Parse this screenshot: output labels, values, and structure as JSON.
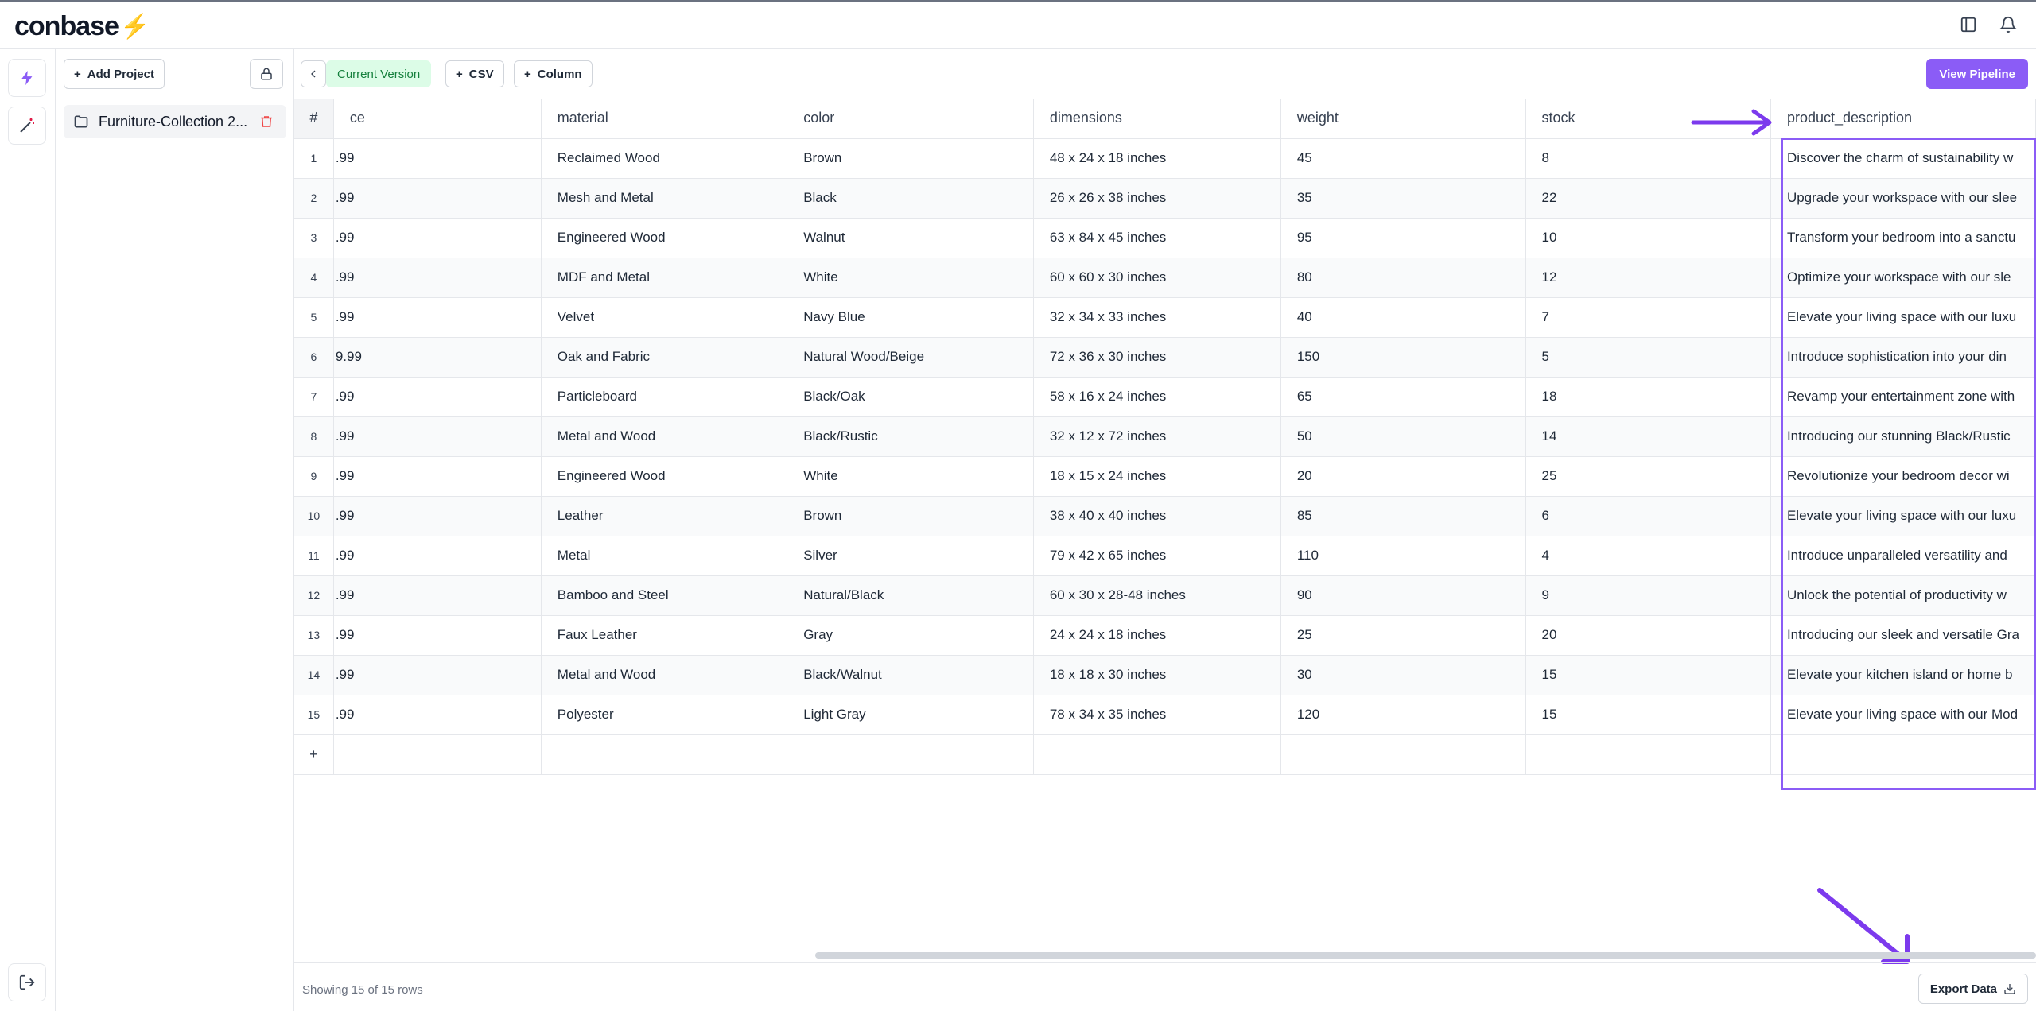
{
  "app": {
    "logo_text": "conbase",
    "logo_bolt": "⚡",
    "accent": "#8b5cf6"
  },
  "header": {
    "icons": [
      "sidebar-toggle-icon",
      "bell-icon"
    ]
  },
  "rail": {
    "items": [
      "bolt-icon",
      "magic-wand-icon"
    ],
    "bottom": "logout-icon"
  },
  "sidebar": {
    "add_project_label": "Add Project",
    "projects": [
      {
        "name": "Furniture-Collection 2..."
      }
    ]
  },
  "toolbar": {
    "version_label": "Current Version",
    "csv_label": "CSV",
    "column_label": "Column",
    "view_pipeline_label": "View Pipeline"
  },
  "table": {
    "columns": [
      "#",
      "ce",
      "material",
      "color",
      "dimensions",
      "weight",
      "stock",
      "product_description"
    ],
    "rows": [
      [
        "1",
        ".99",
        "Reclaimed Wood",
        "Brown",
        "48 x 24 x 18 inches",
        "45",
        "8",
        "Discover the charm of sustainability w"
      ],
      [
        "2",
        ".99",
        "Mesh and Metal",
        "Black",
        "26 x 26 x 38 inches",
        "35",
        "22",
        "Upgrade your workspace with our slee"
      ],
      [
        "3",
        ".99",
        "Engineered Wood",
        "Walnut",
        "63 x 84 x 45 inches",
        "95",
        "10",
        "Transform your bedroom into a sanctu"
      ],
      [
        "4",
        ".99",
        "MDF and Metal",
        "White",
        "60 x 60 x 30 inches",
        "80",
        "12",
        "Optimize your workspace with our sle"
      ],
      [
        "5",
        ".99",
        "Velvet",
        "Navy Blue",
        "32 x 34 x 33 inches",
        "40",
        "7",
        "Elevate your living space with our luxu"
      ],
      [
        "6",
        "9.99",
        "Oak and Fabric",
        "Natural Wood/Beige",
        "72 x 36 x 30 inches",
        "150",
        "5",
        "Introduce sophistication into your din"
      ],
      [
        "7",
        ".99",
        "Particleboard",
        "Black/Oak",
        "58 x 16 x 24 inches",
        "65",
        "18",
        "Revamp your entertainment zone with"
      ],
      [
        "8",
        ".99",
        "Metal and Wood",
        "Black/Rustic",
        "32 x 12 x 72 inches",
        "50",
        "14",
        "Introducing our stunning Black/Rustic"
      ],
      [
        "9",
        ".99",
        "Engineered Wood",
        "White",
        "18 x 15 x 24 inches",
        "20",
        "25",
        "Revolutionize your bedroom decor wi"
      ],
      [
        "10",
        ".99",
        "Leather",
        "Brown",
        "38 x 40 x 40 inches",
        "85",
        "6",
        "Elevate your living space with our luxu"
      ],
      [
        "11",
        ".99",
        "Metal",
        "Silver",
        "79 x 42 x 65 inches",
        "110",
        "4",
        "Introduce unparalleled versatility and"
      ],
      [
        "12",
        ".99",
        "Bamboo and Steel",
        "Natural/Black",
        "60 x 30 x 28-48 inches",
        "90",
        "9",
        "Unlock the potential of productivity w"
      ],
      [
        "13",
        ".99",
        "Faux Leather",
        "Gray",
        "24 x 24 x 18 inches",
        "25",
        "20",
        "Introducing our sleek and versatile Gra"
      ],
      [
        "14",
        ".99",
        "Metal and Wood",
        "Black/Walnut",
        "18 x 18 x 30 inches",
        "30",
        "15",
        "Elevate your kitchen island or home b"
      ],
      [
        "15",
        ".99",
        "Polyester",
        "Light Gray",
        "78 x 34 x 35 inches",
        "120",
        "15",
        "Elevate your living space with our Mod"
      ]
    ],
    "add_row_label": "+"
  },
  "footer": {
    "rows_info": "Showing 15 of 15 rows",
    "export_label": "Export Data"
  }
}
